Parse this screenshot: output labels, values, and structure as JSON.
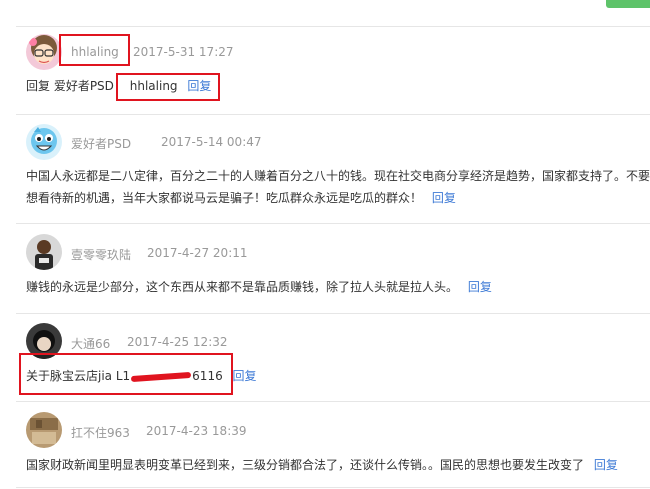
{
  "comments": [
    {
      "username": "hhlaling",
      "time": "2017-5-31 17:27",
      "lines": [
        "回复 爱好者PSD"
      ],
      "mention": "hhlaling",
      "reply_label": "回复"
    },
    {
      "username": "爱好者PSD",
      "time": "2017-5-14 00:47",
      "lines": [
        "中国人永远都是二八定律，百分之二十的人赚着百分之八十的钱。现在社交电商分享经济是趋势，国家都支持了。不要",
        "想看待新的机遇，当年大家都说马云是骗子！吃瓜群众永远是吃瓜的群众！"
      ],
      "reply_label": "回复"
    },
    {
      "username": "壹零零玖陆",
      "time": "2017-4-27 20:11",
      "lines": [
        "赚钱的永远是少部分，这个东西从来都不是靠品质赚钱，除了拉人头就是拉人头。"
      ],
      "reply_label": "回复"
    },
    {
      "username": "大通66",
      "time": "2017-4-25 12:32",
      "lines": [
        "关于脉宝云店jia L1"
      ],
      "line_suffix": "6116",
      "reply_label": "回复"
    },
    {
      "username": "扛不住963",
      "time": "2017-4-23 18:39",
      "lines": [
        "国家财政新闻里明显表明变革已经到来，三级分销都合法了，还谈什么传销。。国民的思想也要发生改变了"
      ],
      "reply_label": "回复"
    }
  ],
  "colors": {
    "username": "#999999",
    "reply_link": "#3f7bd6",
    "highlight_box": "#e0141f",
    "top_tab": "#5ec36a"
  },
  "avatar_icons": [
    "cartoon-girl-icon",
    "cartoon-boy-icon",
    "basketball-player-photo",
    "dark-hair-portrait",
    "room-photo"
  ]
}
